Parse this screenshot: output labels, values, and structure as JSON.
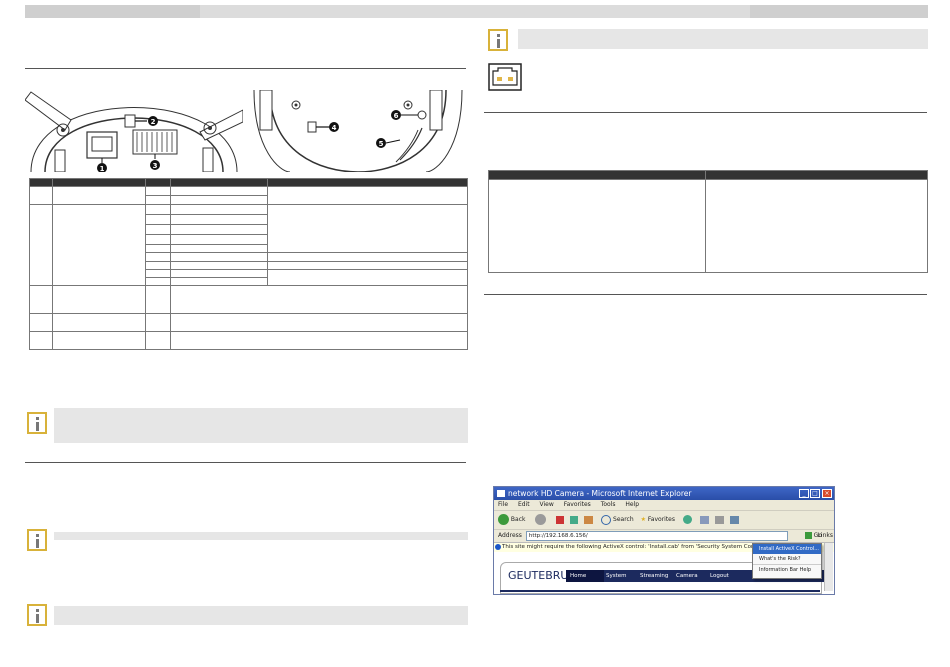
{
  "browser": {
    "title": "network HD Camera - Microsoft Internet Explorer",
    "menu": [
      "File",
      "Edit",
      "View",
      "Favorites",
      "Tools",
      "Help"
    ],
    "toolbar": {
      "back": "Back",
      "search": "Search",
      "favorites": "Favorites"
    },
    "address_label": "Address",
    "address_value": "http://192.168.6.156/",
    "go_label": "Go",
    "links_label": "Links",
    "infobar_text": "This site might require the following ActiveX control: 'Install.cab' from 'Security System Corp.'. Click here to install...",
    "context_menu": [
      "Install ActiveX Control...",
      "What's the Risk?",
      "Information Bar Help"
    ],
    "brand": "GEUTEBRUCK",
    "nav": [
      "Home",
      "System",
      "Streaming",
      "Camera",
      "Logout"
    ]
  },
  "colors": {
    "note_icon_border": "#d8b23a",
    "header_fill": "#333333",
    "ie_titlebar": "#2a4ea8",
    "nav_fill": "#1c2a5e"
  },
  "callouts": [
    "1",
    "2",
    "3",
    "4",
    "5",
    "6"
  ]
}
